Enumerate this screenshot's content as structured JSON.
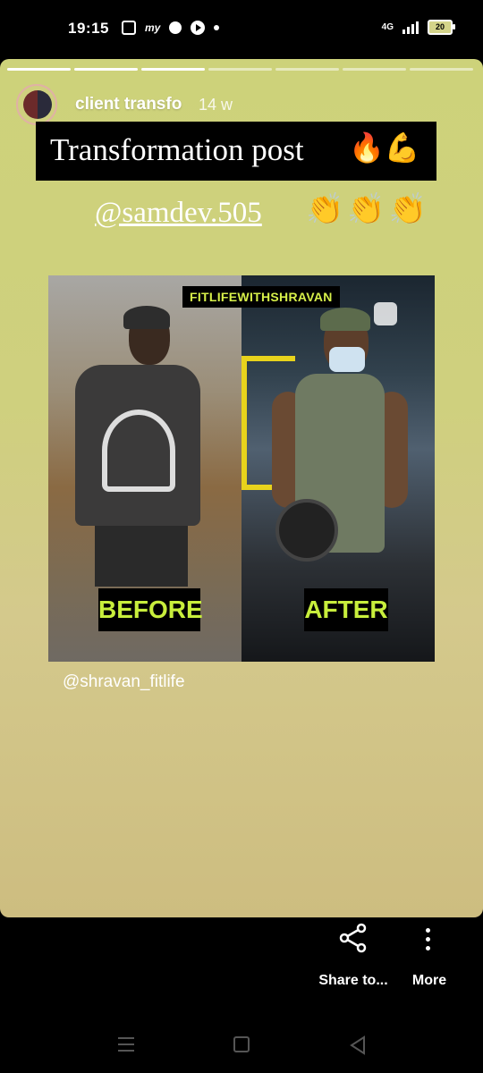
{
  "status_bar": {
    "time": "19:15",
    "app_icons": [
      "notification-icon",
      "my-app-icon",
      "g-icon",
      "play-icon",
      "dot-icon"
    ],
    "network": "4G",
    "battery": "20"
  },
  "story": {
    "progress_total": 7,
    "progress_done": 3,
    "username": "client transfo",
    "age": "14 w",
    "title": "Transformation post",
    "title_emoji": "🔥💪",
    "mention": "@samdev.505",
    "clap_emoji": "👏👏👏",
    "brand_tag": "FITLIFEWITHSHRAVAN",
    "before_label": "BEFORE",
    "after_label": "AFTER",
    "handle": "@shravan_fitlife"
  },
  "actions": {
    "share_label": "Share to...",
    "more_label": "More"
  },
  "colors": {
    "story_bg": "#cfd07e",
    "label_text": "#c8ee3c",
    "title_bg": "#000000"
  }
}
